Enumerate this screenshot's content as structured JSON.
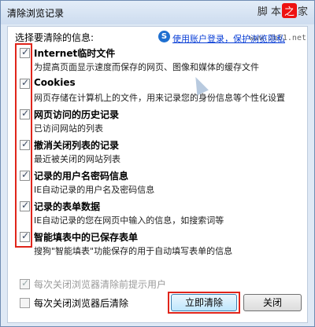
{
  "window": {
    "title": "清除浏览记录",
    "watermark_pre": "脚 本",
    "watermark_brand": "之",
    "watermark_post": "家",
    "watermark_url": "www.Jb51.net"
  },
  "header": {
    "label": "选择要清除的信息:",
    "account_link": "使用账户登录，保护浏览隐私"
  },
  "options": [
    {
      "label": "Internet临时文件",
      "desc": "为提高页面显示速度而保存的网页、图像和媒体的缓存文件",
      "checked": true
    },
    {
      "label": "Cookies",
      "desc": "网页存储在计算机上的文件，用来记录您的身份信息等个性化设置",
      "checked": true
    },
    {
      "label": "网页访问的历史记录",
      "desc": "已访问网站的列表",
      "checked": true
    },
    {
      "label": "撤消关闭列表的记录",
      "desc": "最近被关闭的网站列表",
      "checked": true
    },
    {
      "label": "记录的用户名密码信息",
      "desc": "IE自动记录的用户名及密码信息",
      "checked": true
    },
    {
      "label": "记录的表单数据",
      "desc": "IE自动记录的您在网页中输入的信息，如搜索词等",
      "checked": true
    },
    {
      "label": "智能填表中的已保存表单",
      "desc": "搜狗\"智能填表\"功能保存的用于自动填写表单的信息",
      "checked": true
    }
  ],
  "bottom": {
    "prompt_label": "每次关闭浏览器清除前提示用户",
    "prompt_checked": true,
    "auto_clear_label": "每次关闭浏览器后清除",
    "auto_clear_checked": false,
    "clear_now_label": "立即清除",
    "close_label": "关闭"
  },
  "colors": {
    "highlight": "#e0251b",
    "link": "#0a3fd6"
  }
}
